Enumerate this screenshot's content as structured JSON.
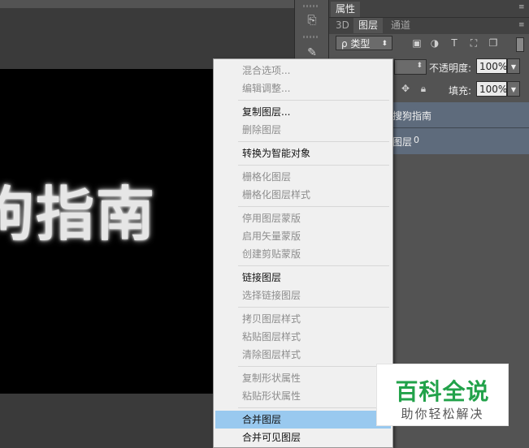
{
  "canvas": {
    "text": "狗指南"
  },
  "panel": {
    "tabs_top": [
      "属性"
    ],
    "tabs": [
      "3D",
      "图层",
      "通道"
    ],
    "filter": {
      "kind_label": "ρ 类型"
    },
    "opacity_label": "不透明度:",
    "opacity_value": "100%",
    "fill_label": "填充:",
    "fill_value": "100%",
    "layers": [
      {
        "name": "搜狗指南"
      },
      {
        "name": "图层",
        "num": "0"
      }
    ]
  },
  "context_menu": {
    "groups": [
      [
        {
          "label": "混合选项...",
          "enabled": false
        },
        {
          "label": "编辑调整...",
          "enabled": false
        }
      ],
      [
        {
          "label": "复制图层...",
          "enabled": true
        },
        {
          "label": "删除图层",
          "enabled": false
        }
      ],
      [
        {
          "label": "转换为智能对象",
          "enabled": true
        }
      ],
      [
        {
          "label": "栅格化图层",
          "enabled": false
        },
        {
          "label": "栅格化图层样式",
          "enabled": false
        }
      ],
      [
        {
          "label": "停用图层蒙版",
          "enabled": false
        },
        {
          "label": "启用矢量蒙版",
          "enabled": false
        },
        {
          "label": "创建剪贴蒙版",
          "enabled": false
        }
      ],
      [
        {
          "label": "链接图层",
          "enabled": true
        },
        {
          "label": "选择链接图层",
          "enabled": false
        }
      ],
      [
        {
          "label": "拷贝图层样式",
          "enabled": false
        },
        {
          "label": "粘贴图层样式",
          "enabled": false
        },
        {
          "label": "清除图层样式",
          "enabled": false
        }
      ],
      [
        {
          "label": "复制形状属性",
          "enabled": false
        },
        {
          "label": "粘贴形状属性",
          "enabled": false
        }
      ],
      [
        {
          "label": "合并图层",
          "enabled": true,
          "highlighted": true
        },
        {
          "label": "合并可见图层",
          "enabled": true
        }
      ]
    ]
  },
  "watermark": {
    "main": "百科全说",
    "sub": "助你轻松解决"
  },
  "colors": {
    "highlight": "#99c9ef",
    "watermark_green": "#22a24a",
    "layer_selected": "#5e6b7c"
  }
}
